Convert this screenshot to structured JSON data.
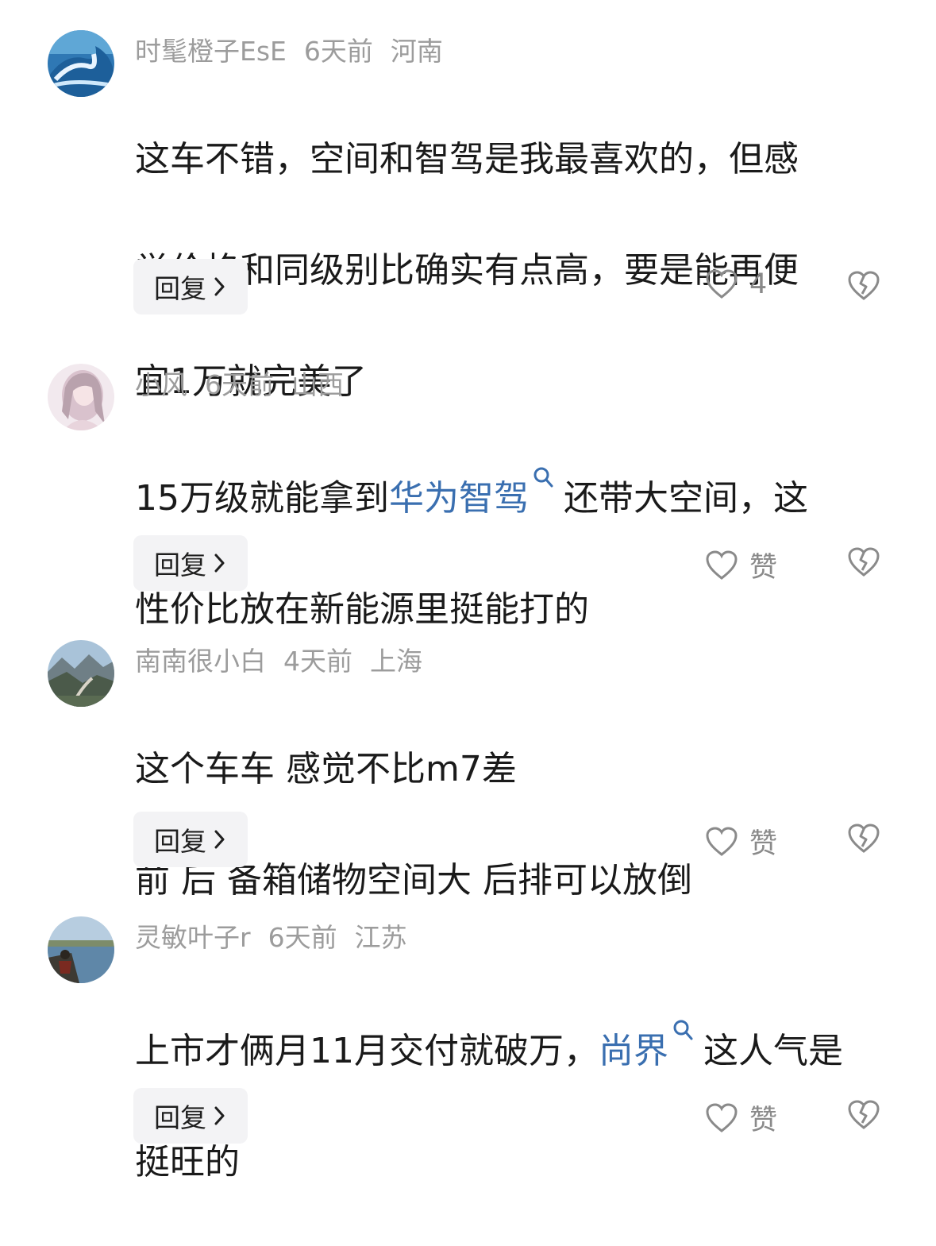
{
  "comments": [
    {
      "username": "时髦橙子EsE",
      "time": "6天前",
      "location": "河南",
      "avatar_icon": "wave-avatar-icon",
      "lines": [
        "这车不错，空间和智驾是我最喜欢的，但感",
        "觉价格和同级别比确实有点高，要是能再便",
        "宜1万就完美了"
      ],
      "reply_label": "回复",
      "like_text": "4"
    },
    {
      "username": "小风",
      "time": "6天前",
      "location": "山西",
      "avatar_icon": "girl-avatar-icon",
      "line1_pre": "15万级就能拿到",
      "line1_topic": "华为智驾",
      "line1_post": "还带大空间，这",
      "line2": "性价比放在新能源里挺能打的",
      "reply_label": "回复",
      "like_text": "赞"
    },
    {
      "username": "南南很小白",
      "time": "4天前",
      "location": "上海",
      "avatar_icon": "landscape-avatar-icon",
      "lines": [
        "这个车车 感觉不比m7差",
        "前 后 备箱储物空间大 后排可以放倒"
      ],
      "reply_label": "回复",
      "like_text": "赞"
    },
    {
      "username": "灵敏叶子r",
      "time": "6天前",
      "location": "江苏",
      "avatar_icon": "lake-avatar-icon",
      "line1_pre": "上市才俩月11月交付就破万，",
      "line1_topic": "尚界",
      "line1_post": "这人气是",
      "line2": "挺旺的",
      "reply_label": "回复",
      "like_text": "赞"
    }
  ],
  "colors": {
    "meta": "#9c9c9c",
    "body": "#1a1a1a",
    "topic": "#3a6fb0",
    "reply_bg": "#f3f3f5"
  }
}
